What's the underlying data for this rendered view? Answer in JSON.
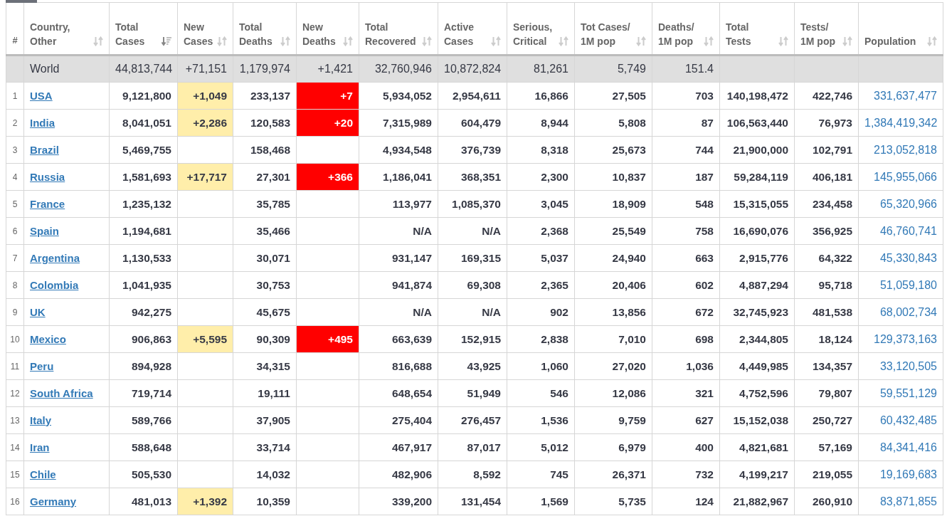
{
  "rank_header": "#",
  "columns": [
    {
      "label": "Country,\nOther",
      "kind": "country",
      "sorted": false
    },
    {
      "label": "Total\nCases",
      "kind": "number",
      "sorted": true
    },
    {
      "label": "New\nCases",
      "kind": "new_cases",
      "sorted": false
    },
    {
      "label": "Total\nDeaths",
      "kind": "number",
      "sorted": false
    },
    {
      "label": "New\nDeaths",
      "kind": "new_deaths",
      "sorted": false
    },
    {
      "label": "Total\nRecovered",
      "kind": "number",
      "sorted": false
    },
    {
      "label": "Active\nCases",
      "kind": "number",
      "sorted": false
    },
    {
      "label": "Serious,\nCritical",
      "kind": "number",
      "sorted": false
    },
    {
      "label": "Tot Cases/\n1M pop",
      "kind": "number",
      "sorted": false
    },
    {
      "label": "Deaths/\n1M pop",
      "kind": "number",
      "sorted": false
    },
    {
      "label": "Total\nTests",
      "kind": "number",
      "sorted": false
    },
    {
      "label": "Tests/\n1M pop",
      "kind": "number",
      "sorted": false
    },
    {
      "label": "Population",
      "kind": "population",
      "sorted": false
    }
  ],
  "world": {
    "country": "World",
    "cells": [
      "44,813,744",
      "+71,151",
      "1,179,974",
      "+1,421",
      "32,760,946",
      "10,872,824",
      "81,261",
      "5,749",
      "151.4",
      null,
      null,
      null
    ]
  },
  "rows": [
    {
      "rank": "1",
      "country": "USA",
      "cells": [
        "9,121,800",
        "+1,049",
        "233,137",
        "+7",
        "5,934,052",
        "2,954,611",
        "16,866",
        "27,505",
        "703",
        "140,198,472",
        "422,746",
        "331,637,477"
      ]
    },
    {
      "rank": "2",
      "country": "India",
      "cells": [
        "8,041,051",
        "+2,286",
        "120,583",
        "+20",
        "7,315,989",
        "604,479",
        "8,944",
        "5,808",
        "87",
        "106,563,440",
        "76,973",
        "1,384,419,342"
      ]
    },
    {
      "rank": "3",
      "country": "Brazil",
      "cells": [
        "5,469,755",
        null,
        "158,468",
        null,
        "4,934,548",
        "376,739",
        "8,318",
        "25,673",
        "744",
        "21,900,000",
        "102,791",
        "213,052,818"
      ]
    },
    {
      "rank": "4",
      "country": "Russia",
      "cells": [
        "1,581,693",
        "+17,717",
        "27,301",
        "+366",
        "1,186,041",
        "368,351",
        "2,300",
        "10,837",
        "187",
        "59,284,119",
        "406,181",
        "145,955,066"
      ]
    },
    {
      "rank": "5",
      "country": "France",
      "cells": [
        "1,235,132",
        null,
        "35,785",
        null,
        "113,977",
        "1,085,370",
        "3,045",
        "18,909",
        "548",
        "15,315,055",
        "234,458",
        "65,320,966"
      ]
    },
    {
      "rank": "6",
      "country": "Spain",
      "cells": [
        "1,194,681",
        null,
        "35,466",
        null,
        "N/A",
        "N/A",
        "2,368",
        "25,549",
        "758",
        "16,690,076",
        "356,925",
        "46,760,741"
      ]
    },
    {
      "rank": "7",
      "country": "Argentina",
      "cells": [
        "1,130,533",
        null,
        "30,071",
        null,
        "931,147",
        "169,315",
        "5,037",
        "24,940",
        "663",
        "2,915,776",
        "64,322",
        "45,330,843"
      ]
    },
    {
      "rank": "8",
      "country": "Colombia",
      "cells": [
        "1,041,935",
        null,
        "30,753",
        null,
        "941,874",
        "69,308",
        "2,365",
        "20,406",
        "602",
        "4,887,294",
        "95,718",
        "51,059,180"
      ]
    },
    {
      "rank": "9",
      "country": "UK",
      "cells": [
        "942,275",
        null,
        "45,675",
        null,
        "N/A",
        "N/A",
        "902",
        "13,856",
        "672",
        "32,745,923",
        "481,538",
        "68,002,734"
      ]
    },
    {
      "rank": "10",
      "country": "Mexico",
      "cells": [
        "906,863",
        "+5,595",
        "90,309",
        "+495",
        "663,639",
        "152,915",
        "2,838",
        "7,010",
        "698",
        "2,344,805",
        "18,124",
        "129,373,163"
      ]
    },
    {
      "rank": "11",
      "country": "Peru",
      "cells": [
        "894,928",
        null,
        "34,315",
        null,
        "816,688",
        "43,925",
        "1,060",
        "27,020",
        "1,036",
        "4,449,985",
        "134,357",
        "33,120,505"
      ]
    },
    {
      "rank": "12",
      "country": "South Africa",
      "cells": [
        "719,714",
        null,
        "19,111",
        null,
        "648,654",
        "51,949",
        "546",
        "12,086",
        "321",
        "4,752,596",
        "79,807",
        "59,551,129"
      ]
    },
    {
      "rank": "13",
      "country": "Italy",
      "cells": [
        "589,766",
        null,
        "37,905",
        null,
        "275,404",
        "276,457",
        "1,536",
        "9,759",
        "627",
        "15,152,038",
        "250,727",
        "60,432,485"
      ]
    },
    {
      "rank": "14",
      "country": "Iran",
      "cells": [
        "588,648",
        null,
        "33,714",
        null,
        "467,917",
        "87,017",
        "5,012",
        "6,979",
        "400",
        "4,821,681",
        "57,169",
        "84,341,416"
      ]
    },
    {
      "rank": "15",
      "country": "Chile",
      "cells": [
        "505,530",
        null,
        "14,032",
        null,
        "482,906",
        "8,592",
        "745",
        "26,371",
        "732",
        "4,199,217",
        "219,055",
        "19,169,683"
      ]
    },
    {
      "rank": "16",
      "country": "Germany",
      "cells": [
        "481,013",
        "+1,392",
        "10,359",
        null,
        "339,200",
        "131,454",
        "1,569",
        "5,735",
        "124",
        "21,882,967",
        "260,910",
        "83,871,855"
      ]
    }
  ]
}
